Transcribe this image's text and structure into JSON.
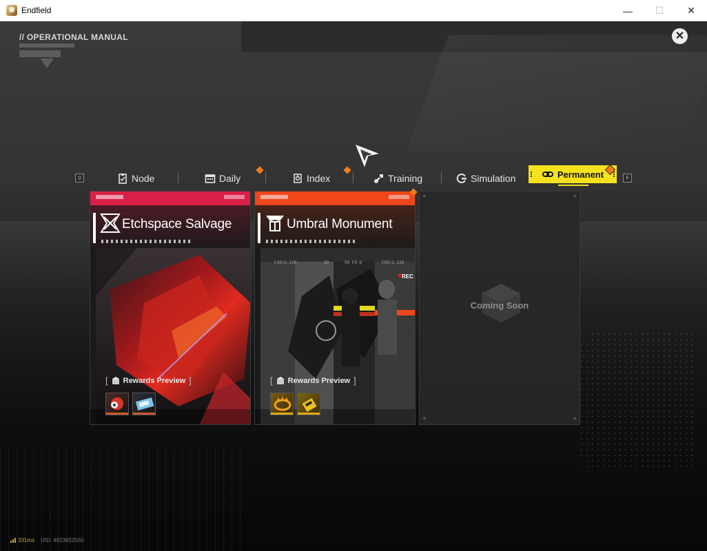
{
  "window": {
    "title": "Endfield",
    "minimize": "—",
    "maximize": "☐",
    "close": "✕"
  },
  "header": {
    "section_title": "// OPERATIONAL MANUAL",
    "close_symbol": "✕"
  },
  "tabs": {
    "prev_key": "Q",
    "next_key": "E",
    "items": [
      {
        "label": "Node",
        "icon": "clipboard-icon",
        "active": false
      },
      {
        "label": "Daily",
        "icon": "calendar-icon",
        "active": false
      },
      {
        "label": "Index",
        "icon": "index-icon",
        "active": false
      },
      {
        "label": "Training",
        "icon": "wrench-icon",
        "active": false
      },
      {
        "label": "Simulation",
        "icon": "simulation-icon",
        "active": false
      },
      {
        "label": "Permanent",
        "icon": "link-icon",
        "active": true
      }
    ],
    "accent": "#f5e21c",
    "notice_color": "#f07a1a"
  },
  "cards": [
    {
      "title": "Etchspace Salvage",
      "rewards_label": "Rewards Preview",
      "header_color": "#d91f47",
      "rewards_count": 2
    },
    {
      "title": "Umbral Monument",
      "rewards_label": "Rewards Preview",
      "header_color": "#f2461a",
      "rec_label": "REC",
      "rewards_count": 2
    },
    {
      "title": "Coming Soon"
    }
  ],
  "footer": {
    "ping": "331ms",
    "uid": "UID: 4923652550"
  }
}
